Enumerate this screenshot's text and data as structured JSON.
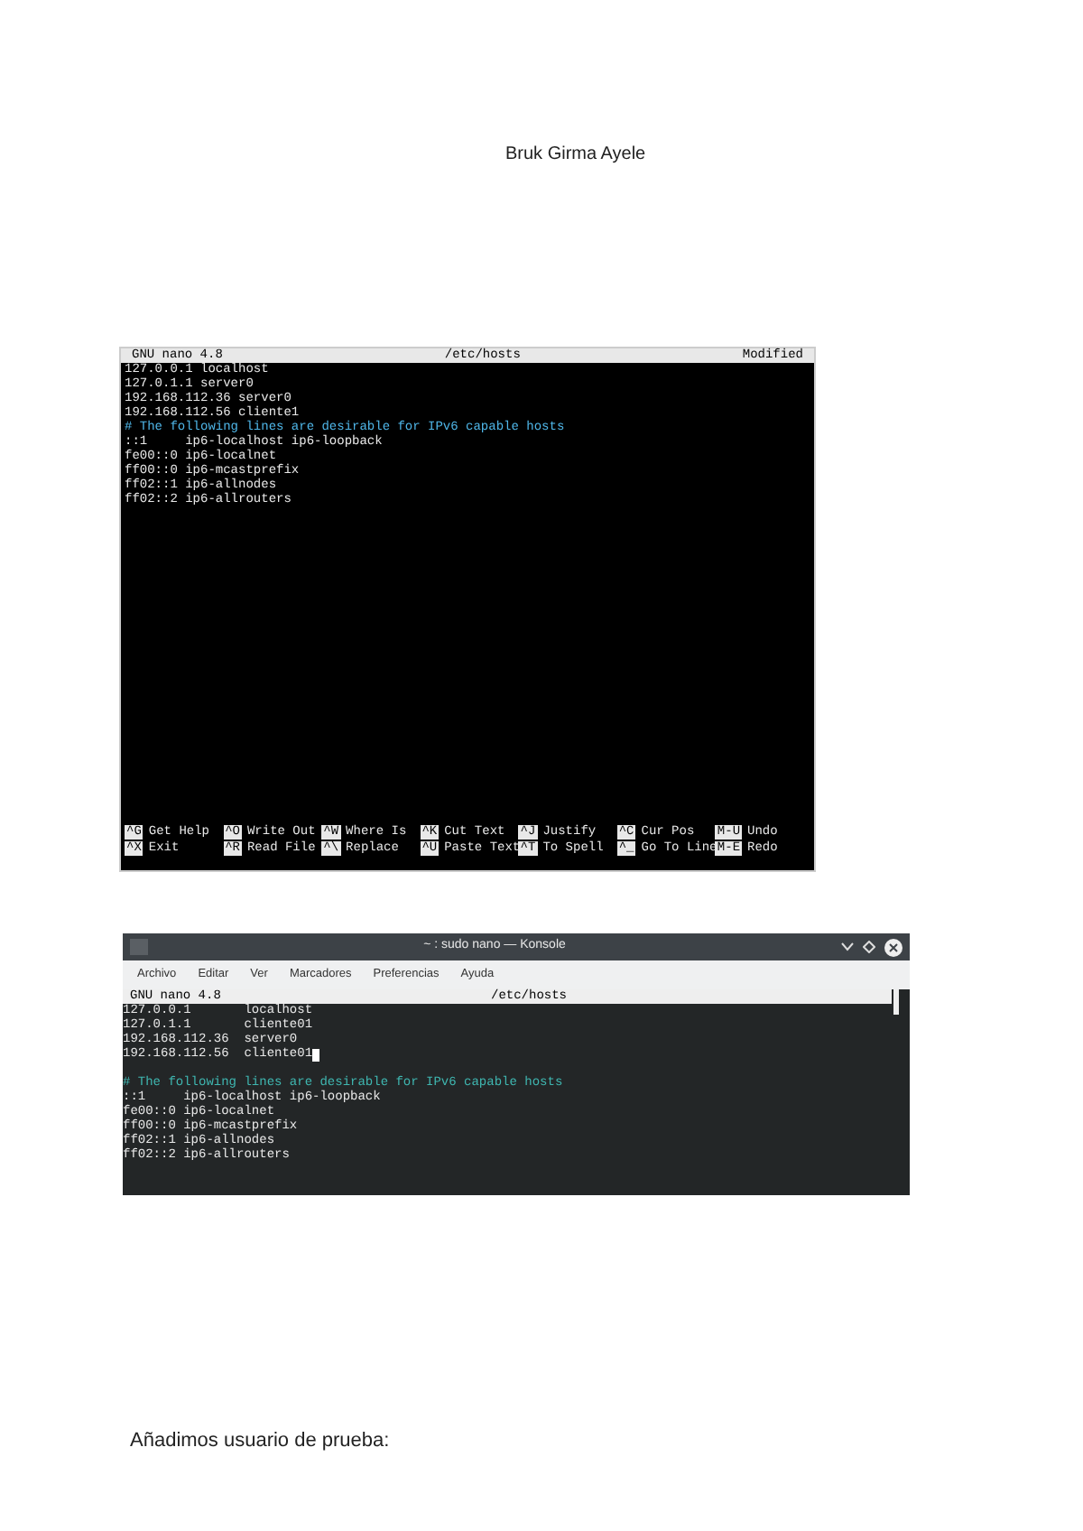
{
  "document": {
    "author": "Bruk Girma Ayele",
    "paragraph": "Añadimos usuario de prueba:"
  },
  "screenshots": [
    {
      "kind": "nano",
      "header": {
        "app": "GNU nano 4.8",
        "file": "/etc/hosts",
        "status": "Modified"
      },
      "lines": [
        {
          "kind": "text",
          "text": "127.0.0.1 localhost",
          "cursor": false
        },
        {
          "kind": "text",
          "text": "127.0.1.1 server0",
          "cursor": false
        },
        {
          "kind": "text",
          "text": "192.168.112.36 server0",
          "cursor": false
        },
        {
          "kind": "text",
          "text": "192.168.112.56 cliente1",
          "cursor": false
        },
        {
          "kind": "comment",
          "text": "# The following lines are desirable for IPv6 capable hosts",
          "cursor": false
        },
        {
          "kind": "text",
          "text": "::1     ip6-localhost ip6-loopback",
          "cursor": false
        },
        {
          "kind": "text",
          "text": "fe00::0 ip6-localnet",
          "cursor": false
        },
        {
          "kind": "text",
          "text": "ff00::0 ip6-mcastprefix",
          "cursor": false
        },
        {
          "kind": "text",
          "text": "ff02::1 ip6-allnodes",
          "cursor": false
        },
        {
          "kind": "text",
          "text": "ff02::2 ip6-allrouters",
          "cursor": false
        }
      ],
      "shortcuts": [
        [
          {
            "key": "^G",
            "label": "Get Help"
          },
          {
            "key": "^O",
            "label": "Write Out"
          },
          {
            "key": "^W",
            "label": "Where Is"
          },
          {
            "key": "^K",
            "label": "Cut Text"
          },
          {
            "key": "^J",
            "label": "Justify"
          },
          {
            "key": "^C",
            "label": "Cur Pos"
          },
          {
            "key": "M-U",
            "label": "Undo"
          }
        ],
        [
          {
            "key": "^X",
            "label": "Exit"
          },
          {
            "key": "^R",
            "label": "Read File"
          },
          {
            "key": "^\\",
            "label": "Replace"
          },
          {
            "key": "^U",
            "label": "Paste Text"
          },
          {
            "key": "^T",
            "label": "To Spell"
          },
          {
            "key": "^_",
            "label": "Go To Line"
          },
          {
            "key": "M-E",
            "label": "Redo"
          }
        ]
      ]
    },
    {
      "kind": "konsole",
      "title": "~ : sudo nano — Konsole",
      "menu": [
        "Archivo",
        "Editar",
        "Ver",
        "Marcadores",
        "Preferencias",
        "Ayuda"
      ],
      "header": {
        "app": "GNU nano 4.8",
        "file": "/etc/hosts"
      },
      "lines": [
        {
          "kind": "text",
          "text": "127.0.0.1       localhost",
          "cursor": false
        },
        {
          "kind": "text",
          "text": "127.0.1.1       cliente01",
          "cursor": false
        },
        {
          "kind": "text",
          "text": "192.168.112.36  server0",
          "cursor": false
        },
        {
          "kind": "text",
          "text": "192.168.112.56  cliente01",
          "cursor": true
        },
        {
          "kind": "blank"
        },
        {
          "kind": "comment",
          "text": "# The following lines are desirable for IPv6 capable hosts",
          "cursor": false
        },
        {
          "kind": "text",
          "text": "::1     ip6-localhost ip6-loopback",
          "cursor": false
        },
        {
          "kind": "text",
          "text": "fe00::0 ip6-localnet",
          "cursor": false
        },
        {
          "kind": "text",
          "text": "ff00::0 ip6-mcastprefix",
          "cursor": false
        },
        {
          "kind": "text",
          "text": "ff02::1 ip6-allnodes",
          "cursor": false
        },
        {
          "kind": "text",
          "text": "ff02::2 ip6-allrouters",
          "cursor": false
        }
      ]
    }
  ]
}
